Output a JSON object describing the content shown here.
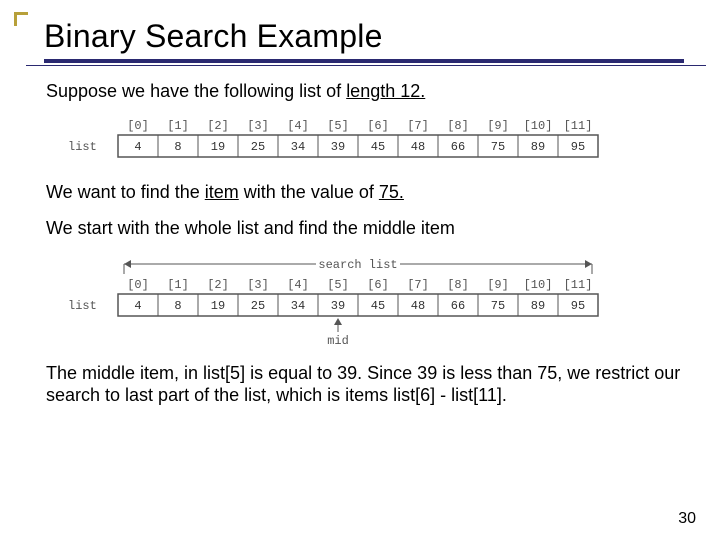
{
  "title": "Binary Search Example",
  "para1_pre": "Suppose we have the following list of ",
  "para1_u": "length 12.",
  "para2_pre": "We want to find the ",
  "para2_u1": "item",
  "para2_mid": " with the value of ",
  "para2_u2": "75.",
  "para3": "We start with the whole list and find the middle item",
  "para4": "The middle item, in list[5] is equal to 39. Since 39 is less than 75, we restrict our search to last part of the list, which is items list[6] - list[11].",
  "page_number": "30",
  "list_label": "list",
  "indices": [
    "[0]",
    "[1]",
    "[2]",
    "[3]",
    "[4]",
    "[5]",
    "[6]",
    "[7]",
    "[8]",
    "[9]",
    "[10]",
    "[11]"
  ],
  "values": [
    "4",
    "8",
    "19",
    "25",
    "34",
    "39",
    "45",
    "48",
    "66",
    "75",
    "89",
    "95"
  ],
  "fig2": {
    "mid_label": "mid",
    "search_label": "search list"
  }
}
